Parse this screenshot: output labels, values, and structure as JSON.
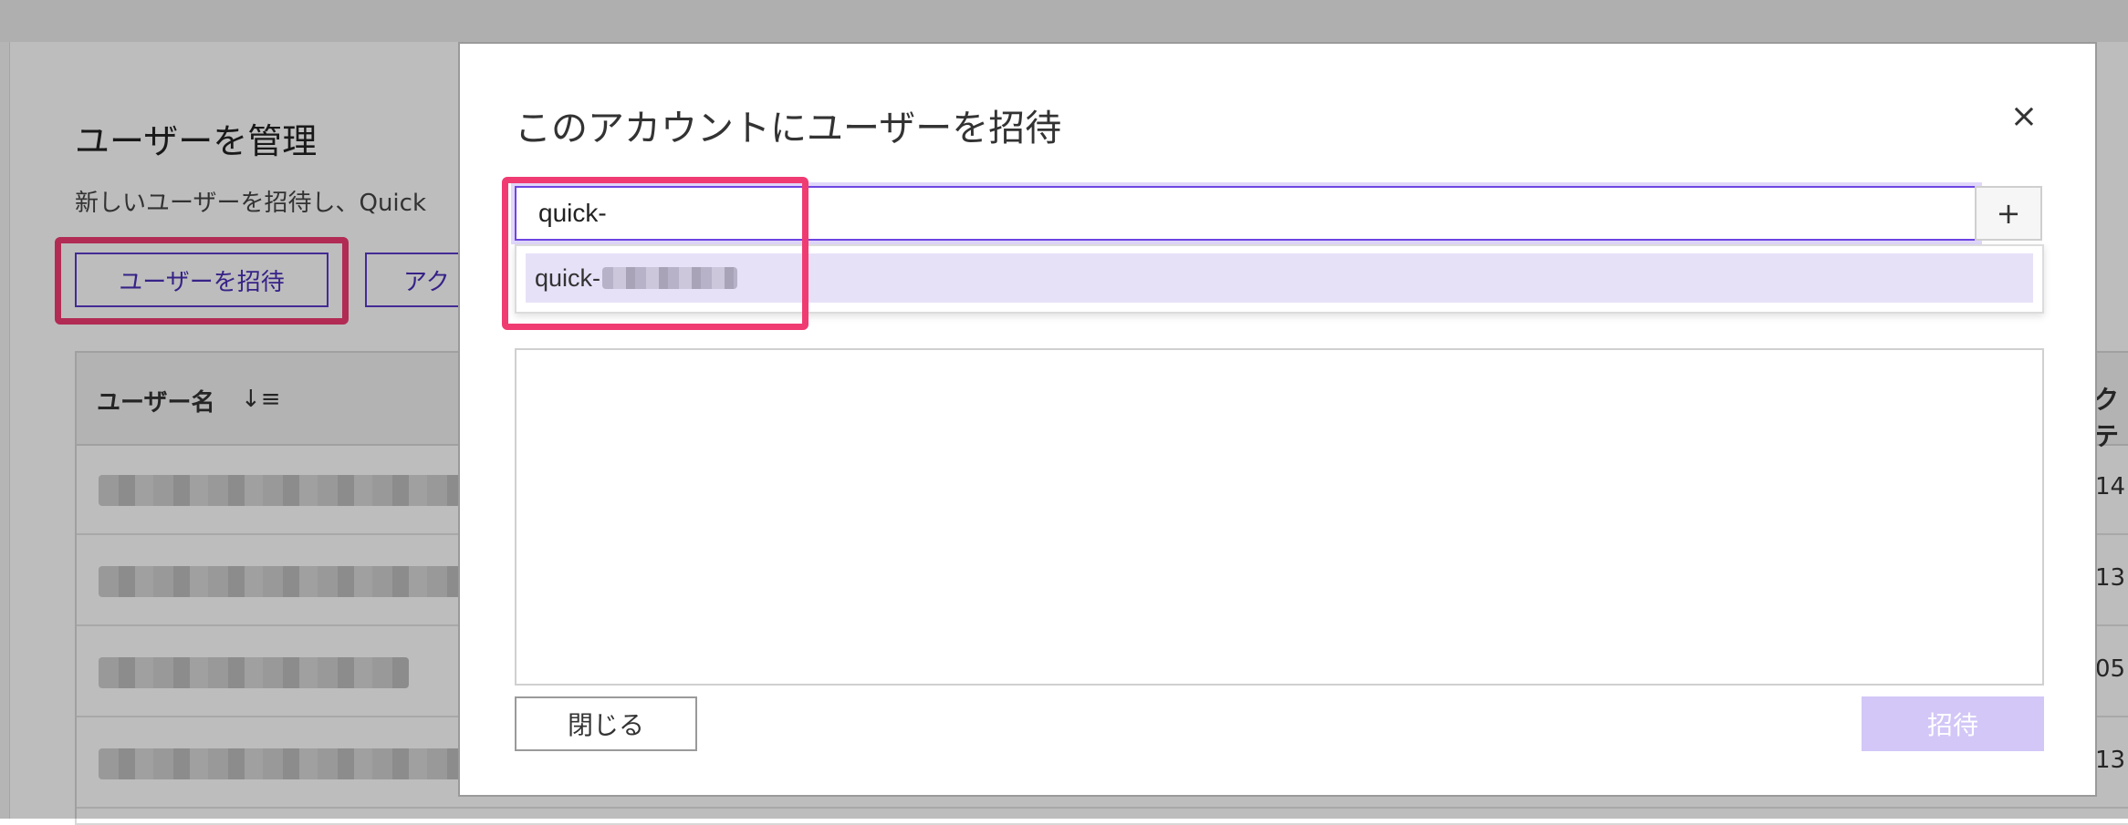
{
  "background": {
    "page_title": "ユーザーを管理",
    "description": "新しいユーザーを招待し、Quick",
    "invite_button": "ユーザーを招待",
    "access_button": "アク",
    "table": {
      "username_header": "ユーザー名",
      "sort_icon": "sort-icon",
      "right_header": "クテ",
      "rows": [
        {
          "name": "",
          "right_value": "14"
        },
        {
          "name": "",
          "right_value": "13"
        },
        {
          "name": "",
          "right_value": "05"
        },
        {
          "name": "",
          "right_value": "13"
        }
      ]
    }
  },
  "modal": {
    "title": "このアカウントにユーザーを招待",
    "close_icon": "×",
    "search": {
      "value": "quick-",
      "placeholder": ""
    },
    "add_button": "+",
    "suggestion": {
      "prefix": "quick-"
    },
    "close_button": "閉じる",
    "invite_button": "招待",
    "colors": {
      "accent": "#6e45e2",
      "highlight": "#f03b72",
      "suggestion_bg": "#e7e1f8",
      "disabled_button": "#d3c7f7"
    }
  }
}
